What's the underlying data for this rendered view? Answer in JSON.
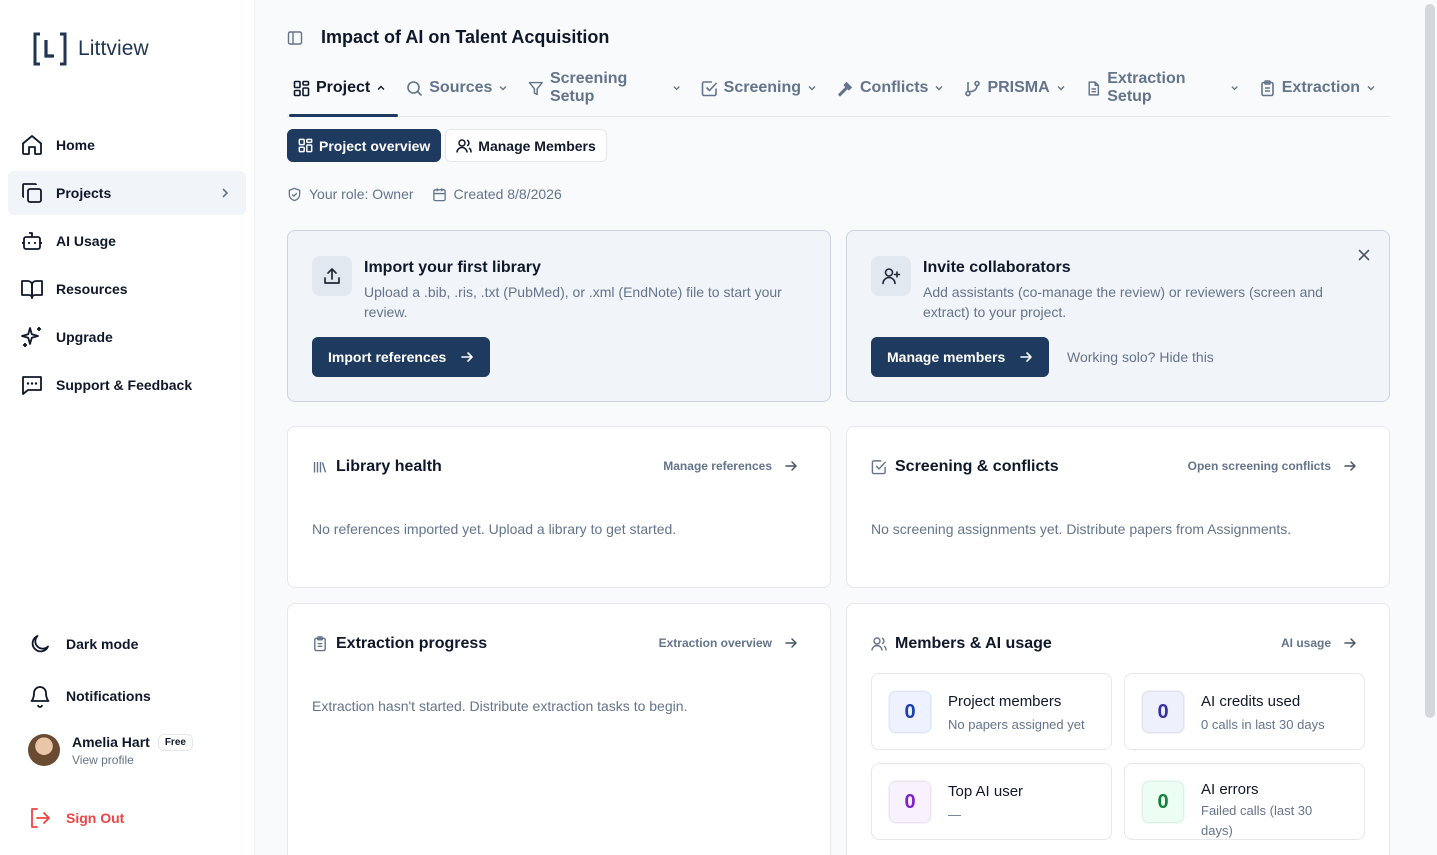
{
  "app": {
    "name": "Littview"
  },
  "sidebar": {
    "items": [
      {
        "label": "Home",
        "icon": "home-icon"
      },
      {
        "label": "Projects",
        "icon": "projects-icon"
      },
      {
        "label": "AI Usage",
        "icon": "bot-icon"
      },
      {
        "label": "Resources",
        "icon": "book-icon"
      },
      {
        "label": "Upgrade",
        "icon": "sparkles-icon"
      },
      {
        "label": "Support & Feedback",
        "icon": "message-icon"
      }
    ],
    "dark_mode": "Dark mode",
    "notifications": "Notifications",
    "user": {
      "name": "Amelia Hart",
      "plan": "Free",
      "view_profile": "View profile"
    },
    "sign_out": "Sign Out"
  },
  "header": {
    "title": "Impact of AI on Talent Acquisition"
  },
  "tabs": [
    {
      "label": "Project"
    },
    {
      "label": "Sources"
    },
    {
      "label": "Screening Setup"
    },
    {
      "label": "Screening"
    },
    {
      "label": "Conflicts"
    },
    {
      "label": "PRISMA"
    },
    {
      "label": "Extraction Setup"
    },
    {
      "label": "Extraction"
    }
  ],
  "subtabs": [
    {
      "label": "Project overview"
    },
    {
      "label": "Manage Members"
    }
  ],
  "meta": {
    "role": "Your role: Owner",
    "created": "Created 8/8/2026"
  },
  "import_card": {
    "title": "Import your first library",
    "description": "Upload a .bib, .ris, .txt (PubMed), or .xml (EndNote) file to start your review.",
    "button": "Import references"
  },
  "invite_card": {
    "title": "Invite collaborators",
    "description": "Add assistants (co-manage the review) or reviewers (screen and extract) to your project.",
    "button": "Manage members",
    "secondary": "Working solo? Hide this"
  },
  "library_card": {
    "title": "Library health",
    "link": "Manage references",
    "empty": "No references imported yet. Upload a library to get started."
  },
  "screening_card": {
    "title": "Screening & conflicts",
    "link": "Open screening conflicts",
    "empty": "No screening assignments yet. Distribute papers from Assignments."
  },
  "extraction_card": {
    "title": "Extraction progress",
    "link": "Extraction overview",
    "empty": "Extraction hasn't started. Distribute extraction tasks to begin."
  },
  "members_card": {
    "title": "Members & AI usage",
    "link": "AI usage",
    "stats": [
      {
        "value": "0",
        "label": "Project members",
        "sub": "No papers assigned yet",
        "color": "#1e40af",
        "bg": "#eef2ff"
      },
      {
        "value": "0",
        "label": "AI credits used",
        "sub": "0 calls in last 30 days",
        "color": "#3730a3",
        "bg": "#eef0fb"
      },
      {
        "value": "0",
        "label": "Top AI user",
        "sub": "—",
        "color": "#7e22ce",
        "bg": "#f7f2fd"
      },
      {
        "value": "0",
        "label": "AI errors",
        "sub": "Failed calls (last 30 days)",
        "color": "#15803d",
        "bg": "#ecfdf3"
      }
    ]
  }
}
